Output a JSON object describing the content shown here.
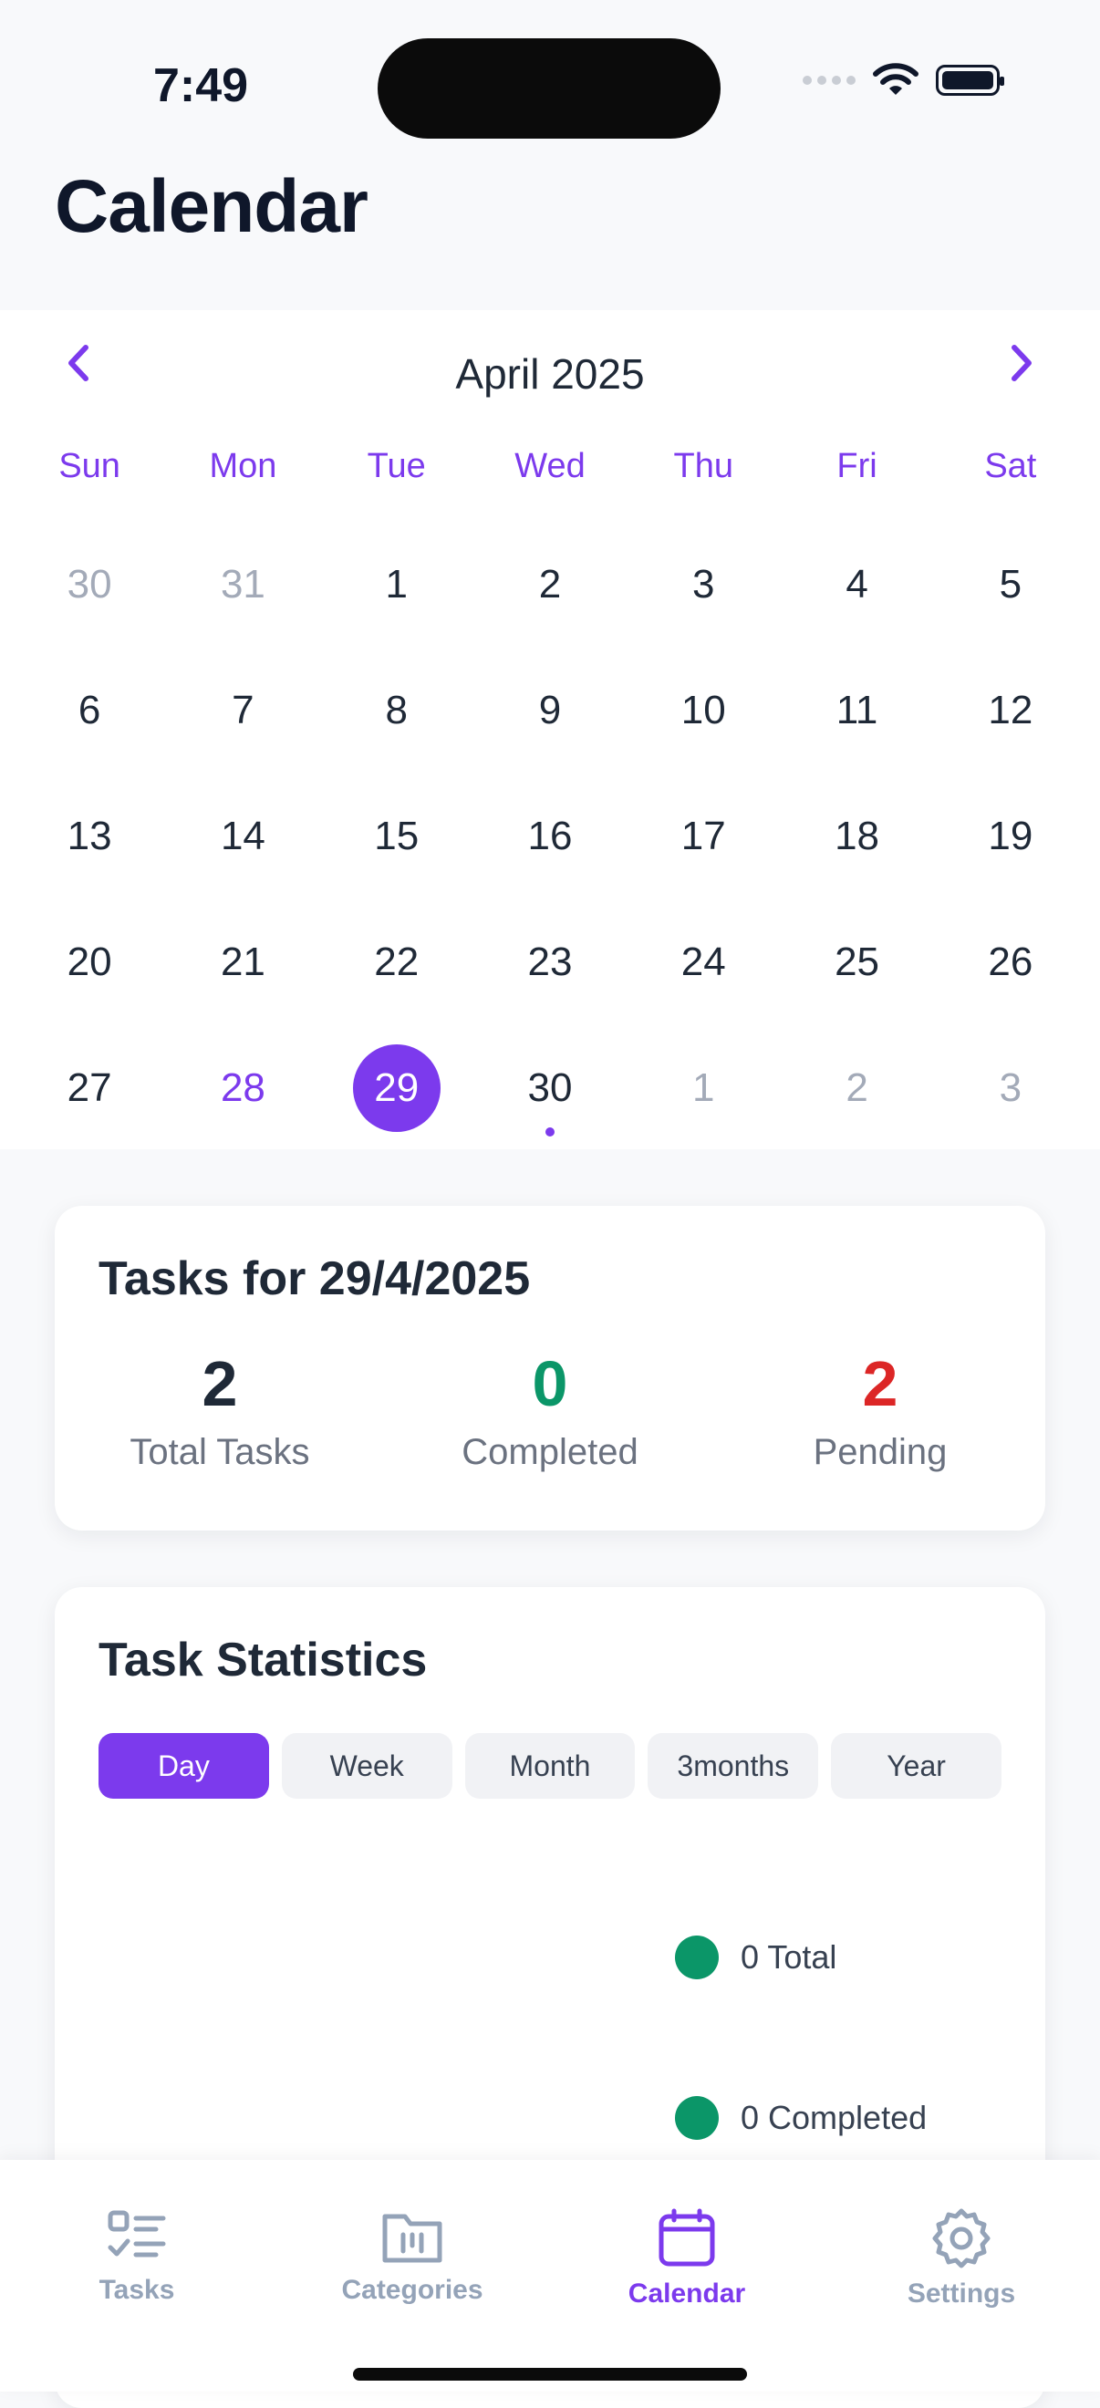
{
  "status_bar": {
    "time": "7:49"
  },
  "header": {
    "title": "Calendar"
  },
  "calendar": {
    "month_label": "April 2025",
    "weekdays": [
      "Sun",
      "Mon",
      "Tue",
      "Wed",
      "Thu",
      "Fri",
      "Sat"
    ],
    "days": [
      {
        "label": "30",
        "state": "outside"
      },
      {
        "label": "31",
        "state": "outside"
      },
      {
        "label": "1",
        "state": "normal"
      },
      {
        "label": "2",
        "state": "normal"
      },
      {
        "label": "3",
        "state": "normal"
      },
      {
        "label": "4",
        "state": "normal"
      },
      {
        "label": "5",
        "state": "normal"
      },
      {
        "label": "6",
        "state": "normal"
      },
      {
        "label": "7",
        "state": "normal"
      },
      {
        "label": "8",
        "state": "normal"
      },
      {
        "label": "9",
        "state": "normal"
      },
      {
        "label": "10",
        "state": "normal"
      },
      {
        "label": "11",
        "state": "normal"
      },
      {
        "label": "12",
        "state": "normal"
      },
      {
        "label": "13",
        "state": "normal"
      },
      {
        "label": "14",
        "state": "normal"
      },
      {
        "label": "15",
        "state": "normal"
      },
      {
        "label": "16",
        "state": "normal"
      },
      {
        "label": "17",
        "state": "normal"
      },
      {
        "label": "18",
        "state": "normal"
      },
      {
        "label": "19",
        "state": "normal"
      },
      {
        "label": "20",
        "state": "normal"
      },
      {
        "label": "21",
        "state": "normal"
      },
      {
        "label": "22",
        "state": "normal"
      },
      {
        "label": "23",
        "state": "normal"
      },
      {
        "label": "24",
        "state": "normal"
      },
      {
        "label": "25",
        "state": "normal"
      },
      {
        "label": "26",
        "state": "normal"
      },
      {
        "label": "27",
        "state": "normal"
      },
      {
        "label": "28",
        "state": "today"
      },
      {
        "label": "29",
        "state": "selected"
      },
      {
        "label": "30",
        "state": "normal",
        "dot": true
      },
      {
        "label": "1",
        "state": "outside"
      },
      {
        "label": "2",
        "state": "outside"
      },
      {
        "label": "3",
        "state": "outside"
      }
    ]
  },
  "tasks_summary": {
    "title": "Tasks for 29/4/2025",
    "stats": [
      {
        "value": "2",
        "label": "Total Tasks",
        "color": "#1f2937"
      },
      {
        "value": "0",
        "label": "Completed",
        "color": "#0b9668"
      },
      {
        "value": "2",
        "label": "Pending",
        "color": "#dc2626"
      }
    ]
  },
  "task_statistics": {
    "title": "Task Statistics",
    "ranges": [
      "Day",
      "Week",
      "Month",
      "3months",
      "Year"
    ],
    "active_range": "Day",
    "legend": [
      "0 Total",
      "0 Completed"
    ],
    "legend_color": "#0b9668"
  },
  "tab_bar": {
    "tabs": [
      {
        "label": "Tasks",
        "icon": "tasks-icon"
      },
      {
        "label": "Categories",
        "icon": "folder-icon"
      },
      {
        "label": "Calendar",
        "icon": "calendar-icon",
        "active": true
      },
      {
        "label": "Settings",
        "icon": "gear-icon"
      }
    ]
  },
  "colors": {
    "accent": "#7c3aed",
    "success": "#0b9668",
    "danger": "#dc2626"
  }
}
